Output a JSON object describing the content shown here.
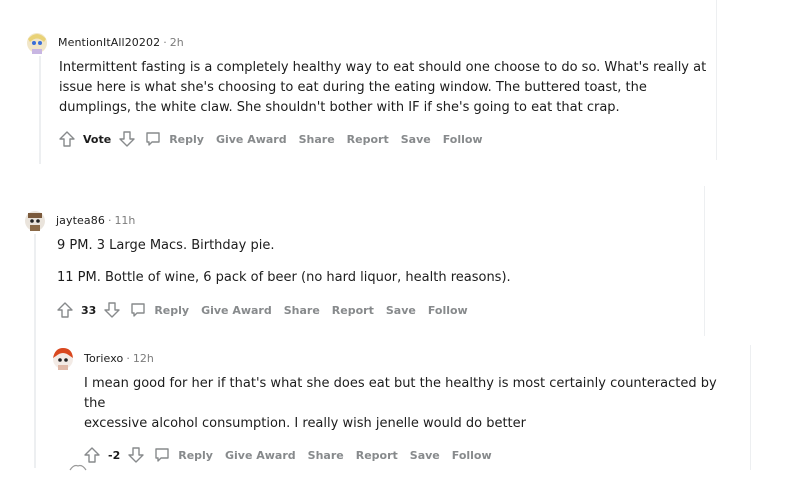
{
  "comments": [
    {
      "username": "MentionItAll20202",
      "time": "2h",
      "paragraphs": [
        "Intermittent fasting is a completely healthy way to eat should one choose to do so. What's really at",
        "issue here is what she's choosing to eat during the eating window. The buttered toast, the",
        "dumplings, the white claw. She shouldn't bother with IF if she's going to eat that crap."
      ],
      "score": "Vote",
      "actions": [
        "Reply",
        "Give Award",
        "Share",
        "Report",
        "Save",
        "Follow"
      ]
    },
    {
      "username": "jaytea86",
      "time": "11h",
      "paragraphs": [
        "9 PM. 3 Large Macs. Birthday pie.",
        "11 PM. Bottle of wine, 6 pack of beer (no hard liquor, health reasons)."
      ],
      "score": "33",
      "actions": [
        "Reply",
        "Give Award",
        "Share",
        "Report",
        "Save",
        "Follow"
      ]
    },
    {
      "username": "Toriexo",
      "time": "12h",
      "paragraphs": [
        "I mean good for her if that's what she does eat but the healthy is most certainly counteracted by the",
        "excessive alcohol consumption. I really wish jenelle would do better"
      ],
      "score": "-2",
      "actions": [
        "Reply",
        "Give Award",
        "Share",
        "Report",
        "Save",
        "Follow"
      ]
    }
  ],
  "separator": "·",
  "colors": {
    "meta": "#7c7c7c",
    "action": "#878a8c",
    "thread_line": "#edeff1"
  }
}
